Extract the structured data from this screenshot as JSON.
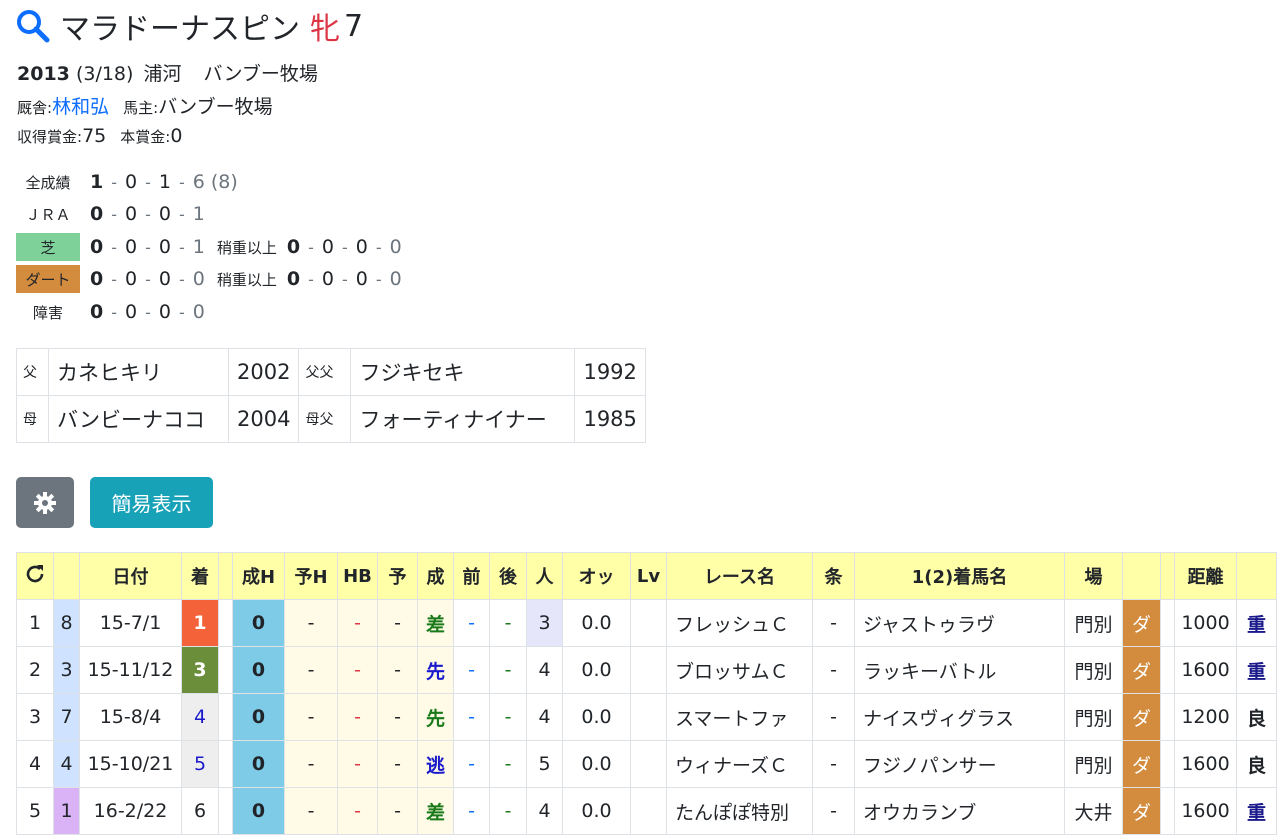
{
  "horse": {
    "name": "マラドーナスピン",
    "sex": "牝",
    "age": "7"
  },
  "birth": {
    "year": "2013",
    "date": "(3/18)",
    "place": "浦河",
    "breeder": "バンブー牧場"
  },
  "stable": {
    "label": "厩舎:",
    "trainer": "林和弘",
    "owner_label": "馬主:",
    "owner": "バンブー牧場"
  },
  "prize": {
    "earned_label": "収得賞金:",
    "earned": "75",
    "main_label": "本賞金:",
    "main": "0"
  },
  "records": [
    {
      "label": "全成績",
      "w": "1",
      "s": "0",
      "t": "1",
      "o": "6",
      "extra": "(8)",
      "color": "",
      "sub": null
    },
    {
      "label": "ＪＲＡ",
      "w": "0",
      "s": "0",
      "t": "0",
      "o": "1",
      "extra": "",
      "color": "",
      "sub": null
    },
    {
      "label": "芝",
      "w": "0",
      "s": "0",
      "t": "0",
      "o": "1",
      "extra": "",
      "color": "#7fd19a",
      "sub": {
        "label": "稍重以上",
        "w": "0",
        "s": "0",
        "t": "0",
        "o": "0"
      }
    },
    {
      "label": "ダート",
      "w": "0",
      "s": "0",
      "t": "0",
      "o": "0",
      "extra": "",
      "color": "#d38b3e",
      "sub": {
        "label": "稍重以上",
        "w": "0",
        "s": "0",
        "t": "0",
        "o": "0"
      }
    },
    {
      "label": "障害",
      "w": "0",
      "s": "0",
      "t": "0",
      "o": "0",
      "extra": "",
      "color": "",
      "sub": null
    }
  ],
  "pedigree": [
    {
      "k1": "父",
      "n1": "カネヒキリ",
      "y1": "2002",
      "k2": "父父",
      "n2": "フジキセキ",
      "y2": "1992"
    },
    {
      "k1": "母",
      "n1": "バンビーナココ",
      "y1": "2004",
      "k2": "母父",
      "n2": "フォーティナイナー",
      "y2": "1985"
    }
  ],
  "buttons": {
    "simple": "簡易表示"
  },
  "icons": {
    "search": "search-icon",
    "gear": "gear-icon",
    "refresh": "refresh-icon"
  },
  "columns": [
    "",
    "",
    "日付",
    "着",
    "",
    "成H",
    "予H",
    "HB",
    "予",
    "成",
    "前",
    "後",
    "人",
    "オッ",
    "Lv",
    "レース名",
    "条",
    "1(2)着馬名",
    "場",
    "",
    "",
    "距離",
    ""
  ],
  "races": [
    {
      "no": "1",
      "waku": "8",
      "wakuColor": "#cfe2ff",
      "date": "15-7/1",
      "rank": "1",
      "rankBg": "#f4623a",
      "rankFg": "#ffffff",
      "seiH": "0",
      "yoH": "-",
      "hb": "-",
      "yo": "-",
      "sei": "差",
      "seiColor": "#1a7a1a",
      "mae": "-",
      "ato": "-",
      "pop": "3",
      "popBg": "#e6e6fa",
      "odds": "0.0",
      "lv": "",
      "race": "フレッシュＣ",
      "cond": "-",
      "winner": "ジャストゥラヴ",
      "course": "門別",
      "track": "ダ",
      "dist": "1000",
      "going": "重",
      "goingColor": "#1a1a8c"
    },
    {
      "no": "2",
      "waku": "3",
      "wakuColor": "#cfe2ff",
      "date": "15-11/12",
      "rank": "3",
      "rankBg": "#6b8e3a",
      "rankFg": "#ffffff",
      "seiH": "0",
      "yoH": "-",
      "hb": "-",
      "yo": "-",
      "sei": "先",
      "seiColor": "#1a1acc",
      "mae": "-",
      "ato": "-",
      "pop": "4",
      "popBg": "",
      "odds": "0.0",
      "lv": "",
      "race": "ブロッサムＣ",
      "cond": "-",
      "winner": "ラッキーバトル",
      "course": "門別",
      "track": "ダ",
      "dist": "1600",
      "going": "重",
      "goingColor": "#1a1a8c"
    },
    {
      "no": "3",
      "waku": "7",
      "wakuColor": "#cfe2ff",
      "date": "15-8/4",
      "rank": "4",
      "rankBg": "#eeeeee",
      "rankFg": "#1a1acc",
      "seiH": "0",
      "yoH": "-",
      "hb": "-",
      "yo": "-",
      "sei": "先",
      "seiColor": "#1a7a1a",
      "mae": "-",
      "ato": "-",
      "pop": "4",
      "popBg": "",
      "odds": "0.0",
      "lv": "",
      "race": "スマートファ",
      "cond": "-",
      "winner": "ナイスヴィグラス",
      "course": "門別",
      "track": "ダ",
      "dist": "1200",
      "going": "良",
      "goingColor": "#212529"
    },
    {
      "no": "4",
      "waku": "4",
      "wakuColor": "#cfe2ff",
      "date": "15-10/21",
      "rank": "5",
      "rankBg": "#eeeeee",
      "rankFg": "#1a1acc",
      "seiH": "0",
      "yoH": "-",
      "hb": "-",
      "yo": "-",
      "sei": "逃",
      "seiColor": "#1a1acc",
      "mae": "-",
      "ato": "-",
      "pop": "5",
      "popBg": "",
      "odds": "0.0",
      "lv": "",
      "race": "ウィナーズＣ",
      "cond": "-",
      "winner": "フジノパンサー",
      "course": "門別",
      "track": "ダ",
      "dist": "1600",
      "going": "良",
      "goingColor": "#212529"
    },
    {
      "no": "5",
      "waku": "1",
      "wakuColor": "#d9b3f5",
      "date": "16-2/22",
      "rank": "6",
      "rankBg": "#ffffff",
      "rankFg": "#212529",
      "seiH": "0",
      "yoH": "-",
      "hb": "-",
      "yo": "-",
      "sei": "差",
      "seiColor": "#1a7a1a",
      "mae": "-",
      "ato": "-",
      "pop": "4",
      "popBg": "",
      "odds": "0.0",
      "lv": "",
      "race": "たんぽぽ特別",
      "cond": "-",
      "winner": "オウカランブ",
      "course": "大井",
      "track": "ダ",
      "dist": "1600",
      "going": "重",
      "goingColor": "#1a1a8c"
    }
  ]
}
